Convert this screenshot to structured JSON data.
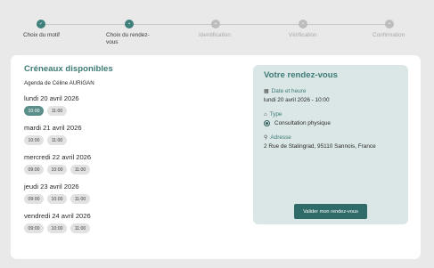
{
  "stepper": {
    "steps": [
      {
        "label": "Choix du motif",
        "state": "done",
        "icon": "check-icon",
        "glyph": "✓"
      },
      {
        "label": "Choix du rendez-\nvous",
        "state": "active",
        "icon": "current-step-icon",
        "glyph": "•"
      },
      {
        "label": "Identification",
        "state": "todo",
        "icon": "pending-step-icon",
        "glyph": "•"
      },
      {
        "label": "Vérification",
        "state": "todo",
        "icon": "pending-step-icon",
        "glyph": "•"
      },
      {
        "label": "Confirmation",
        "state": "todo",
        "icon": "pending-step-icon",
        "glyph": "•"
      }
    ]
  },
  "slots": {
    "title": "Créneaux disponibles",
    "practitioner": "Agenda de Céline AURIGAN",
    "days": [
      {
        "label": "lundi 20 avril 2026",
        "times": [
          "10:00",
          "11:00"
        ],
        "selected": "10:00"
      },
      {
        "label": "mardi 21 avril 2026",
        "times": [
          "10:00",
          "11:00"
        ],
        "selected": ""
      },
      {
        "label": "mercredi 22 avril 2026",
        "times": [
          "09:00",
          "10:00",
          "11:00"
        ],
        "selected": ""
      },
      {
        "label": "jeudi 23 avril 2026",
        "times": [
          "09:00",
          "10:00",
          "11:00"
        ],
        "selected": ""
      },
      {
        "label": "vendredi 24 avril 2026",
        "times": [
          "09:00",
          "10:00",
          "11:00"
        ],
        "selected": ""
      }
    ]
  },
  "summary": {
    "title": "Votre rendez-vous",
    "date_heading": "Date et heure",
    "date_value": "lundi 20 avril 2026 - 10:00",
    "type_heading": "Type",
    "type_value": "Consultation physique",
    "address_heading": "Adresse",
    "address_value": "2 Rue de Stalingrad, 95110 Sannois, France",
    "validate_label": "Valider mon rendez-vous"
  },
  "colors": {
    "accent": "#3d7a75",
    "button": "#2f6b68",
    "panel": "#dbe7e6",
    "chip_selected": "#5a8e8a"
  }
}
